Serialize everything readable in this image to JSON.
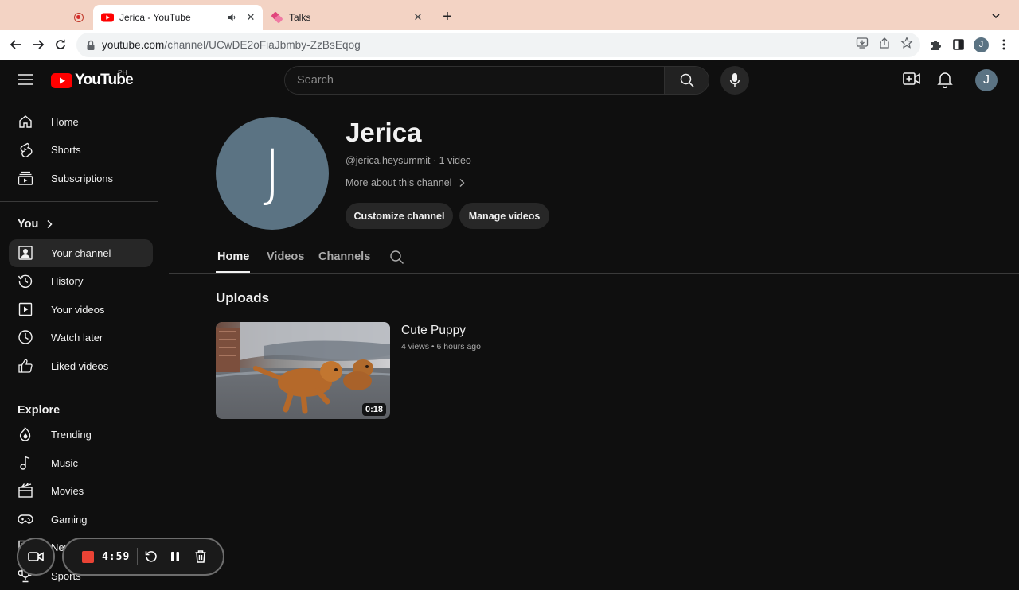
{
  "browser": {
    "tabs": [
      {
        "title": "Jerica - YouTube",
        "active": true
      },
      {
        "title": "Talks",
        "active": false
      }
    ],
    "url_host": "youtube.com",
    "url_path": "/channel/UCwDE2oFiaJbmby-ZzBsEqog",
    "profile_initial": "J"
  },
  "masthead": {
    "logo_text": "YouTube",
    "country_code": "PH",
    "search_placeholder": "Search",
    "avatar_initial": "J"
  },
  "sidebar": {
    "main": [
      {
        "label": "Home",
        "icon": "home-icon"
      },
      {
        "label": "Shorts",
        "icon": "shorts-icon"
      },
      {
        "label": "Subscriptions",
        "icon": "subscriptions-icon"
      }
    ],
    "you_heading": "You",
    "you": [
      {
        "label": "Your channel",
        "icon": "your-channel-icon",
        "selected": true
      },
      {
        "label": "History",
        "icon": "history-icon"
      },
      {
        "label": "Your videos",
        "icon": "your-videos-icon"
      },
      {
        "label": "Watch later",
        "icon": "watch-later-icon"
      },
      {
        "label": "Liked videos",
        "icon": "liked-videos-icon"
      }
    ],
    "explore_heading": "Explore",
    "explore": [
      {
        "label": "Trending",
        "icon": "trending-icon"
      },
      {
        "label": "Music",
        "icon": "music-icon"
      },
      {
        "label": "Movies",
        "icon": "movies-icon"
      },
      {
        "label": "Gaming",
        "icon": "gaming-icon"
      },
      {
        "label": "News",
        "icon": "news-icon"
      },
      {
        "label": "Sports",
        "icon": "sports-icon"
      }
    ]
  },
  "channel": {
    "avatar_initial": "J",
    "name": "Jerica",
    "handle_meta": "@jerica.heysummit · 1 video",
    "more_about": "More about this channel",
    "customize_button": "Customize channel",
    "manage_button": "Manage videos",
    "tabs": [
      "Home",
      "Videos",
      "Channels"
    ],
    "active_tab": "Home"
  },
  "uploads": {
    "heading": "Uploads",
    "videos": [
      {
        "title": "Cute Puppy",
        "meta": "4 views • 6 hours ago",
        "duration": "0:18"
      }
    ]
  },
  "recorder": {
    "time": "4:59"
  },
  "colors": {
    "background": "#0f0f0f",
    "youtube_red": "#ff0000",
    "avatar": "#5b7383",
    "tab_strip": "#f3d3c4",
    "record_red": "#ea4335"
  }
}
